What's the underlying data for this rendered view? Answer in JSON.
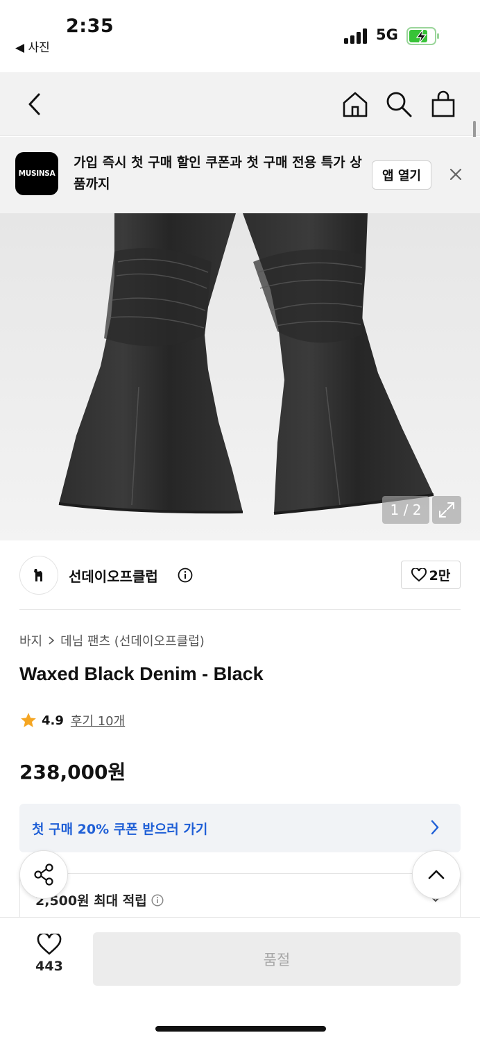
{
  "status_bar": {
    "time": "2:35",
    "back_label": "◀ 사진",
    "network": "5G",
    "battery_color": "#37c337"
  },
  "nav": {
    "icons": [
      "back-chevron-icon",
      "home-icon",
      "search-icon",
      "shopping-bag-icon"
    ]
  },
  "banner": {
    "logo_text": "MUSINSA",
    "message": "가입 즉시 첫 구매 할인 쿠폰과 첫 구매 전용 특가 상품까지",
    "open_app_label": "앱 열기",
    "close_icon": "close-icon"
  },
  "gallery": {
    "counter": "1 / 2",
    "expand_icon": "expand-icon"
  },
  "brand": {
    "name": "선데이오프클럽",
    "like_count": "2만"
  },
  "product": {
    "breadcrumb": [
      "바지",
      "데님 팬츠 (선데이오프클럽)"
    ],
    "title": "Waxed Black Denim - Black",
    "rating": "4.9",
    "reviews": "후기 10개",
    "price": "238,000원",
    "rating_color": "#f5a623"
  },
  "coupon": {
    "text": "첫 구매 20% 쿠폰 받으러 가기",
    "color": "#1f5fd6"
  },
  "points": {
    "text": "2,500원 최대 적립"
  },
  "bottom": {
    "wish_count": "443",
    "soldout_label": "품절"
  }
}
